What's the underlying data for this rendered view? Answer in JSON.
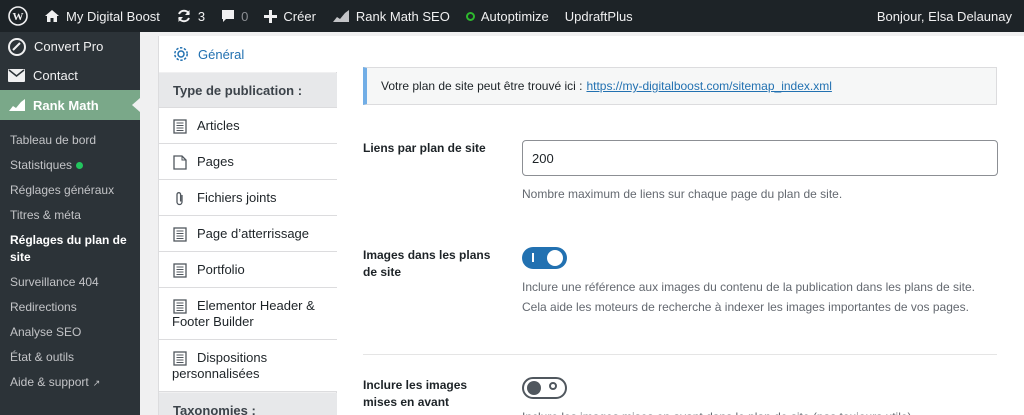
{
  "adminbar": {
    "site_name": "My Digital Boost",
    "updates_count": "3",
    "comments_count": "0",
    "new_label": "Créer",
    "rankmath_label": "Rank Math SEO",
    "autoptimize_label": "Autoptimize",
    "updraft_label": "UpdraftPlus",
    "greeting": "Bonjour, Elsa Delaunay"
  },
  "sidebar": {
    "convertpro": "Convert Pro",
    "contact": "Contact",
    "rankmath": "Rank Math",
    "items": [
      {
        "label": "Tableau de bord"
      },
      {
        "label": "Statistiques"
      },
      {
        "label": "Réglages généraux"
      },
      {
        "label": "Titres & méta"
      },
      {
        "label": "Réglages du plan de site"
      },
      {
        "label": "Surveillance 404"
      },
      {
        "label": "Redirections"
      },
      {
        "label": "Analyse SEO"
      },
      {
        "label": "État & outils"
      },
      {
        "label": "Aide & support"
      }
    ]
  },
  "tabs": {
    "general": "Général",
    "section_post_types": "Type de publication :",
    "items": [
      {
        "label": "Articles"
      },
      {
        "label": "Pages"
      },
      {
        "label": "Fichiers joints"
      },
      {
        "label": "Page d’atterrissage"
      },
      {
        "label": "Portfolio"
      },
      {
        "label": "Elementor Header & Footer Builder"
      },
      {
        "label": "Dispositions personnalisées"
      }
    ],
    "section_taxonomies": "Taxonomies :"
  },
  "notice": {
    "text": "Votre plan de site peut être trouvé ici :",
    "link": "https://my-digitalboost.com/sitemap_index.xml"
  },
  "settings": {
    "links_label": "Liens par plan de site",
    "links_value": "200",
    "links_desc": "Nombre maximum de liens sur chaque page du plan de site.",
    "images_label": "Images dans les plans de site",
    "images_enabled": true,
    "images_desc": "Inclure une référence aux images du contenu de la publication dans les plans de site. Cela aide les moteurs de recherche à indexer les images importantes de vos pages.",
    "featured_label": "Inclure les images mises en avant",
    "featured_enabled": false,
    "featured_desc": "Inclure les images mises en avant dans le plan de site (pas toujours utile)"
  },
  "colors": {
    "adminbar_bg": "#1d2327",
    "sidebar_bg": "#2c3338",
    "active_menu": "#7aa889",
    "link_blue": "#2271b1",
    "toggle_on": "#2271b1"
  }
}
